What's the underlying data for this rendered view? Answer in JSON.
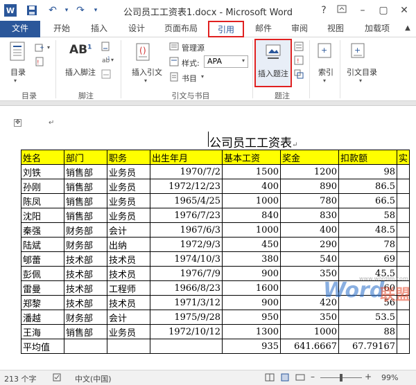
{
  "titlebar": {
    "title": "公司员工工资表1.docx - Microsoft Word",
    "help": "?",
    "word_logo": "W"
  },
  "tabs": [
    "文件",
    "开始",
    "插入",
    "设计",
    "页面布局",
    "引用",
    "邮件",
    "审阅",
    "视图",
    "加载项"
  ],
  "ribbon": {
    "toc": {
      "label": "目录",
      "group": "目录"
    },
    "footnote": {
      "label": "插入脚注",
      "group": "脚注",
      "icon_text": "AB",
      "icon_sup": "1"
    },
    "citation": {
      "insert_label": "插入引文",
      "manage": "管理源",
      "style_label": "样式:",
      "style_value": "APA",
      "bib_label": "书目",
      "group": "引文与书目"
    },
    "caption": {
      "label": "插入题注",
      "group": "题注"
    },
    "index": {
      "label": "索引"
    },
    "toa": {
      "label": "引文目录"
    }
  },
  "document": {
    "title": "公司员工工资表",
    "table": {
      "headers": [
        "姓名",
        "部门",
        "职务",
        "出生年月",
        "基本工资",
        "奖金",
        "扣款额",
        "实"
      ],
      "rows": [
        [
          "刘铁",
          "销售部",
          "业务员",
          "1970/7/2",
          "1500",
          "1200",
          "98"
        ],
        [
          "孙刚",
          "销售部",
          "业务员",
          "1972/12/23",
          "400",
          "890",
          "86.5"
        ],
        [
          "陈凤",
          "销售部",
          "业务员",
          "1965/4/25",
          "1000",
          "780",
          "66.5"
        ],
        [
          "沈阳",
          "销售部",
          "业务员",
          "1976/7/23",
          "840",
          "830",
          "58"
        ],
        [
          "秦强",
          "财务部",
          "会计",
          "1967/6/3",
          "1000",
          "400",
          "48.5"
        ],
        [
          "陆斌",
          "财务部",
          "出纳",
          "1972/9/3",
          "450",
          "290",
          "78"
        ],
        [
          "郇蕾",
          "技术部",
          "技术员",
          "1974/10/3",
          "380",
          "540",
          "69"
        ],
        [
          "彭佩",
          "技术部",
          "技术员",
          "1976/7/9",
          "900",
          "350",
          "45.5"
        ],
        [
          "雷曼",
          "技术部",
          "工程师",
          "1966/8/23",
          "1600",
          "",
          "60"
        ],
        [
          "郑黎",
          "技术部",
          "技术员",
          "1971/3/12",
          "900",
          "420",
          "56"
        ],
        [
          "潘越",
          "财务部",
          "会计",
          "1975/9/28",
          "950",
          "350",
          "53.5"
        ],
        [
          "王海",
          "销售部",
          "业务员",
          "1972/10/12",
          "1300",
          "1000",
          "88"
        ]
      ],
      "footer": [
        "平均值",
        "",
        "",
        "",
        "935",
        "641.6667",
        "67.79167"
      ]
    },
    "watermark": {
      "brand": "Word",
      "cn": "联盟",
      "url": "www.wordlm.com"
    }
  },
  "statusbar": {
    "word_count": "213 个字",
    "language": "中文(中国)",
    "zoom": "99%"
  }
}
